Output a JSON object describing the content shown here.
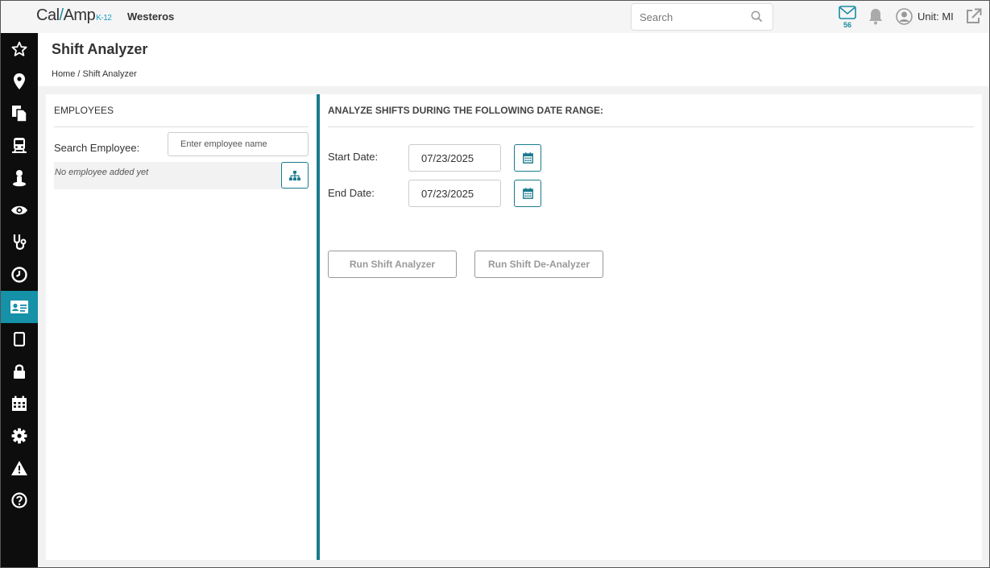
{
  "topbar": {
    "logo": {
      "part1": "Cal",
      "slash": "/",
      "part2": "Amp",
      "suffix": "K-12"
    },
    "org_name": "Westeros",
    "search": {
      "placeholder": "Search",
      "value": ""
    },
    "mail_count": "56",
    "unit_label": "Unit: MI"
  },
  "sidebar": {
    "accent_color": "#1591a8",
    "items": [
      {
        "icon": "star-icon"
      },
      {
        "icon": "map-marker-icon"
      },
      {
        "icon": "documents-icon"
      },
      {
        "icon": "bus-icon"
      },
      {
        "icon": "person-icon"
      },
      {
        "icon": "eye-icon"
      },
      {
        "icon": "stethoscope-icon"
      },
      {
        "icon": "clock-icon"
      },
      {
        "icon": "id-card-icon",
        "active": true
      },
      {
        "icon": "tablet-icon"
      },
      {
        "icon": "lock-icon"
      },
      {
        "icon": "calendar-icon"
      },
      {
        "icon": "gear-icon"
      },
      {
        "icon": "warning-icon"
      },
      {
        "icon": "help-icon"
      }
    ]
  },
  "page": {
    "title": "Shift Analyzer",
    "breadcrumb": "Home / Shift Analyzer"
  },
  "employees": {
    "title": "EMPLOYEES",
    "search_label": "Search Employee:",
    "search_placeholder": "Enter employee name",
    "empty_text": "No employee added yet"
  },
  "analyze": {
    "title": "ANALYZE SHIFTS DURING THE FOLLOWING DATE RANGE:",
    "start_label": "Start Date:",
    "start_value": "07/23/2025",
    "end_label": "End Date:",
    "end_value": "07/23/2025",
    "run_label": "Run Shift Analyzer",
    "deanalyze_label": "Run Shift De-Analyzer"
  }
}
